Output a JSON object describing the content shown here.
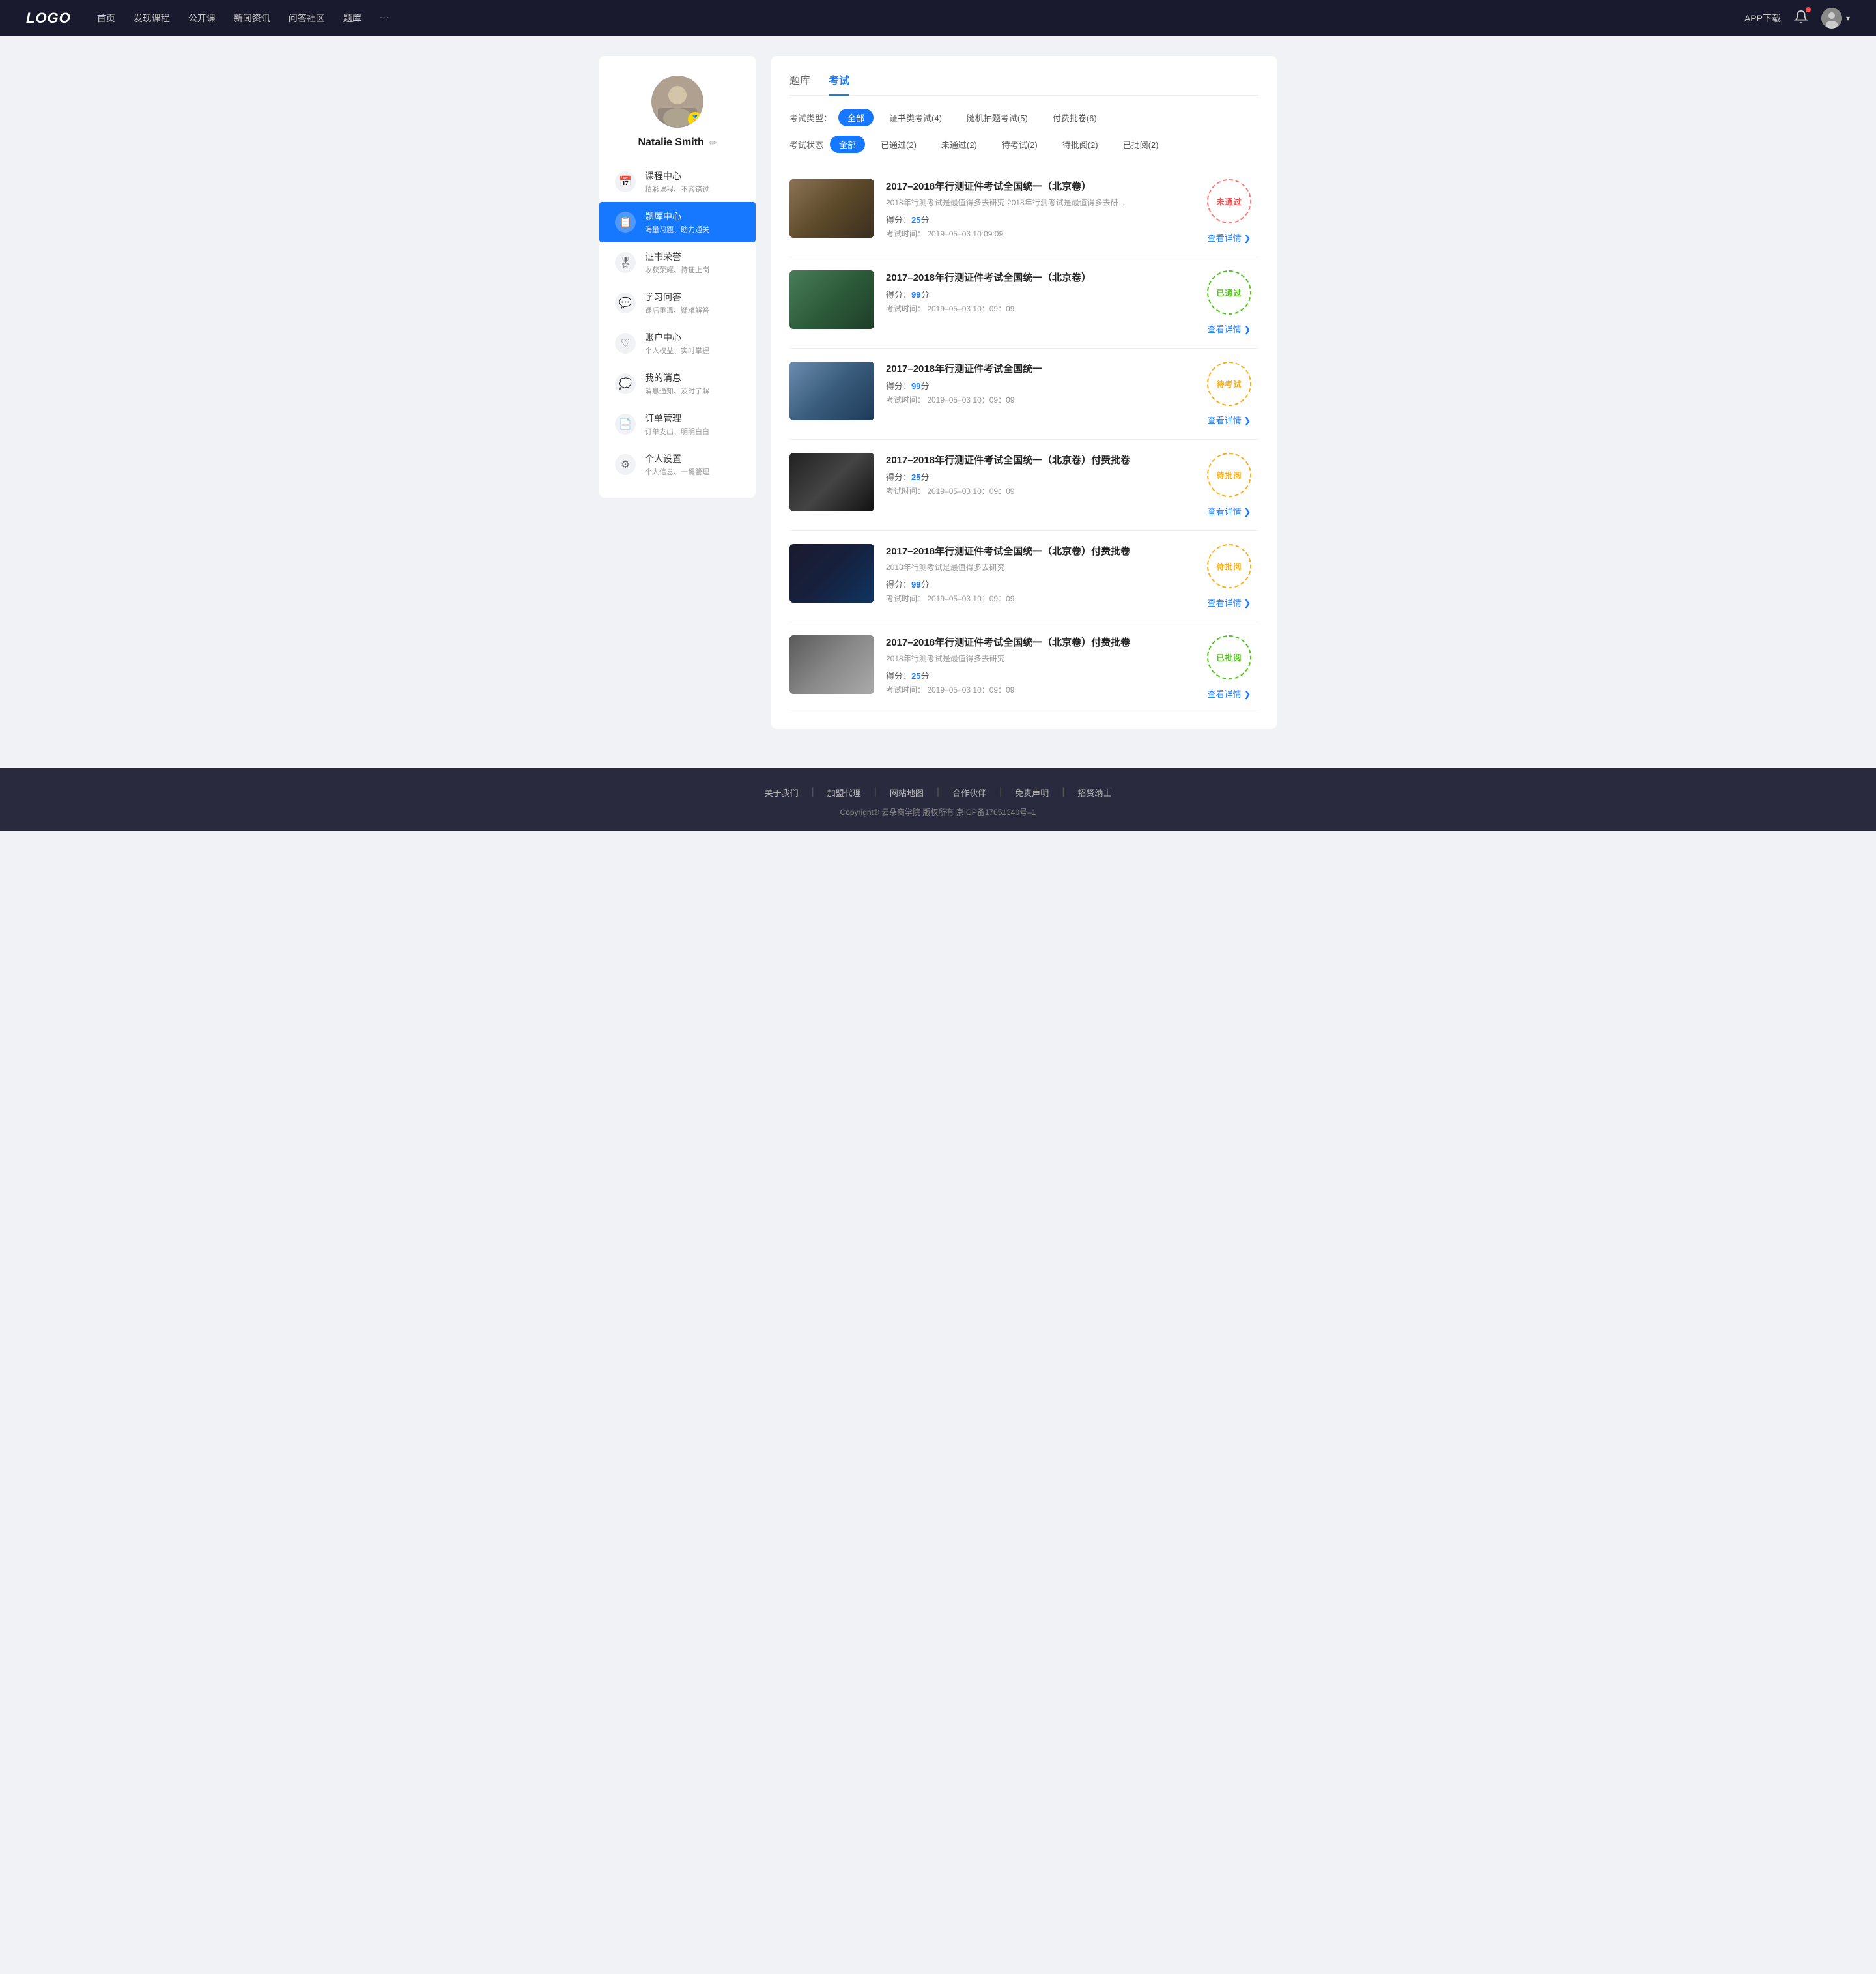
{
  "navbar": {
    "logo": "LOGO",
    "links": [
      {
        "label": "首页",
        "href": "#"
      },
      {
        "label": "发现课程",
        "href": "#"
      },
      {
        "label": "公开课",
        "href": "#"
      },
      {
        "label": "新闻资讯",
        "href": "#"
      },
      {
        "label": "问答社区",
        "href": "#"
      },
      {
        "label": "题库",
        "href": "#"
      },
      {
        "label": "···",
        "href": "#"
      }
    ],
    "app_download": "APP下载",
    "user_menu_arrow": "▾"
  },
  "sidebar": {
    "avatar_alt": "用户头像",
    "badge_icon": "🏅",
    "user_name": "Natalie Smith",
    "edit_icon": "✏",
    "menu": [
      {
        "id": "course",
        "icon": "📅",
        "title": "课程中心",
        "sub": "精彩课程、不容错过",
        "active": false
      },
      {
        "id": "question-bank",
        "icon": "📋",
        "title": "题库中心",
        "sub": "海量习题、助力通关",
        "active": true
      },
      {
        "id": "certificate",
        "icon": "🎖",
        "title": "证书荣誉",
        "sub": "收获荣耀、持证上岗",
        "active": false
      },
      {
        "id": "qa",
        "icon": "💬",
        "title": "学习问答",
        "sub": "课后重温、疑难解答",
        "active": false
      },
      {
        "id": "account",
        "icon": "♡",
        "title": "账户中心",
        "sub": "个人权益、实时掌握",
        "active": false
      },
      {
        "id": "messages",
        "icon": "💭",
        "title": "我的消息",
        "sub": "消息通知、及时了解",
        "active": false
      },
      {
        "id": "orders",
        "icon": "📄",
        "title": "订单管理",
        "sub": "订单支出、明明白白",
        "active": false
      },
      {
        "id": "settings",
        "icon": "⚙",
        "title": "个人设置",
        "sub": "个人信息、一键管理",
        "active": false
      }
    ]
  },
  "content": {
    "tab_question_bank": "题库",
    "tab_exam": "考试",
    "active_tab": "exam",
    "type_filter": {
      "label": "考试类型：",
      "options": [
        {
          "label": "全部",
          "active": true
        },
        {
          "label": "证书类考试(4)",
          "active": false
        },
        {
          "label": "随机抽题考试(5)",
          "active": false
        },
        {
          "label": "付费批卷(6)",
          "active": false
        }
      ]
    },
    "status_filter": {
      "label": "考试状态",
      "options": [
        {
          "label": "全部",
          "active": true
        },
        {
          "label": "已通过(2)",
          "active": false
        },
        {
          "label": "未通过(2)",
          "active": false
        },
        {
          "label": "待考试(2)",
          "active": false
        },
        {
          "label": "待批阅(2)",
          "active": false
        },
        {
          "label": "已批阅(2)",
          "active": false
        }
      ]
    },
    "exams": [
      {
        "id": 1,
        "thumb_class": "thumb-1",
        "title": "2017–2018年行测证件考试全国统一（北京卷）",
        "desc": "2018年行测考试是最值得多去研究 2018年行测考试是最值得多去研究 2018年行…",
        "score_label": "得分：",
        "score": "25",
        "score_unit": "分",
        "time_label": "考试时间：",
        "time": "2019–05–03  10:09:09",
        "status_label": "未通过",
        "status_class": "badge-failed",
        "detail_link": "查看详情"
      },
      {
        "id": 2,
        "thumb_class": "thumb-2",
        "title": "2017–2018年行测证件考试全国统一（北京卷）",
        "desc": "",
        "score_label": "得分：",
        "score": "99",
        "score_unit": "分",
        "time_label": "考试时间：",
        "time": "2019–05–03  10：09：09",
        "status_label": "已通过",
        "status_class": "badge-passed",
        "detail_link": "查看详情"
      },
      {
        "id": 3,
        "thumb_class": "thumb-3",
        "title": "2017–2018年行测证件考试全国统一",
        "desc": "",
        "score_label": "得分：",
        "score": "99",
        "score_unit": "分",
        "time_label": "考试时间：",
        "time": "2019–05–03  10：09：09",
        "status_label": "待考试",
        "status_class": "badge-pending",
        "detail_link": "查看详情"
      },
      {
        "id": 4,
        "thumb_class": "thumb-4",
        "title": "2017–2018年行测证件考试全国统一（北京卷）付费批卷",
        "desc": "",
        "score_label": "得分：",
        "score": "25",
        "score_unit": "分",
        "time_label": "考试时间：",
        "time": "2019–05–03  10：09：09",
        "status_label": "待批阅",
        "status_class": "badge-pending",
        "detail_link": "查看详情"
      },
      {
        "id": 5,
        "thumb_class": "thumb-5",
        "title": "2017–2018年行测证件考试全国统一（北京卷）付费批卷",
        "desc": "2018年行测考试是最值得多去研究",
        "score_label": "得分：",
        "score": "99",
        "score_unit": "分",
        "time_label": "考试时间：",
        "time": "2019–05–03  10：09：09",
        "status_label": "待批阅",
        "status_class": "badge-pending",
        "detail_link": "查看详情"
      },
      {
        "id": 6,
        "thumb_class": "thumb-6",
        "title": "2017–2018年行测证件考试全国统一（北京卷）付费批卷",
        "desc": "2018年行测考试是最值得多去研究",
        "score_label": "得分：",
        "score": "25",
        "score_unit": "分",
        "time_label": "考试时间：",
        "time": "2019–05–03  10：09：09",
        "status_label": "已批阅",
        "status_class": "badge-reviewed",
        "detail_link": "查看详情"
      }
    ]
  },
  "footer": {
    "links": [
      {
        "label": "关于我们"
      },
      {
        "label": "加盟代理"
      },
      {
        "label": "网站地图"
      },
      {
        "label": "合作伙伴"
      },
      {
        "label": "免责声明"
      },
      {
        "label": "招贤纳士"
      }
    ],
    "copyright": "Copyright® 云朵商学院  版权所有    京ICP备17051340号–1"
  }
}
